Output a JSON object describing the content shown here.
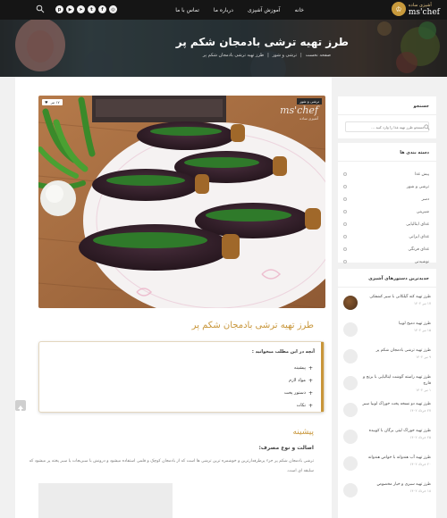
{
  "header": {
    "logo_text": "ms'chef",
    "logo_sub": "آشپزی ساده",
    "nav": [
      {
        "label": "خانه"
      },
      {
        "label": "آموزش آشپزی"
      },
      {
        "label": "درباره ما"
      },
      {
        "label": "تماس با ما"
      }
    ],
    "socials": [
      "pinterest-icon",
      "youtube-icon",
      "telegram-icon",
      "twitter-icon",
      "facebook-icon",
      "instagram-icon"
    ]
  },
  "hero": {
    "title": "طرز تهیه ترشی بادمجان شکم پر",
    "breadcrumb": [
      "صفحه نخست",
      "ترشی و شور",
      "طرز تهیه ترشی بادمجان شکم پر"
    ]
  },
  "post": {
    "category_badge": "ترشی و شور",
    "date_badge": "۱۷ تیر",
    "watermark": "ms'chef",
    "watermark_sub": "آشپزی ساده",
    "title": "طرز تهیه ترشی بادمجان شکم پر",
    "toc_title": "آنچه در این مطلب میخوانید :",
    "toc": [
      "پیشینه",
      "مواد لازم",
      "دستور پخت",
      "نکات"
    ],
    "h2": "پیشینه",
    "h3": "اصالت و نوع مصرف:",
    "paragraph": "ترشی بادمجان شکم پر جزء پرطرفدارترین و خوشمزه ترین ترشی ها است که از بادمجان کوچک و قلمی استفاده میشود و درونش با سبزیجات یا سیر پخته پر میشود که سلیقه ای است."
  },
  "sidebar": {
    "search": {
      "title": "جستجو",
      "placeholder": "جستجو طرز تهیه غذا را وارد کنید ..."
    },
    "categories": {
      "title": "دسته بندی ها",
      "items": [
        "پیش غذا",
        "ترشی و شور",
        "دسر",
        "شیرینی",
        "غذای ایتالیایی",
        "غذای ایرانی",
        "غذای فرنگی",
        "نوشیدنی"
      ]
    },
    "popular": {
      "title": "جدیدترین دستورهای آشپزی",
      "items": [
        {
          "title": "طرز تهیه کته گیلکانی با سیر کشفکی",
          "date": "۱۷ تیر ۱۴۰۲"
        },
        {
          "title": "طرز تهیه دمپخ لوبیا",
          "date": "۱۵ تیر ۱۴۰۲"
        },
        {
          "title": "طرز تهیه ترشی بادمجان شکم پر",
          "date": "۹ تیر ۱۴۰۲"
        },
        {
          "title": "طرز تهیه راسته گوشت ایتالیایی با برنج و قارچ",
          "date": "۱ تیر ۱۴۰۲"
        },
        {
          "title": "طرز تهیه دو نسخه پخت خوراک لوبیا سبز",
          "date": "۲۷ خرداد ۱۴۰۲"
        },
        {
          "title": "طرز تهیه خوراک لیتی برگان با کوبیده",
          "date": "۲۵ خرداد ۱۴۰۲"
        },
        {
          "title": "طرز تهیه آب هندوانه با خواص هندوانه",
          "date": "۲۰ خرداد ۱۴۰۲"
        },
        {
          "title": "طرز تهیه سبزی و خیار مخصوص",
          "date": "۱۸ خرداد ۱۴۰۲"
        }
      ]
    }
  }
}
